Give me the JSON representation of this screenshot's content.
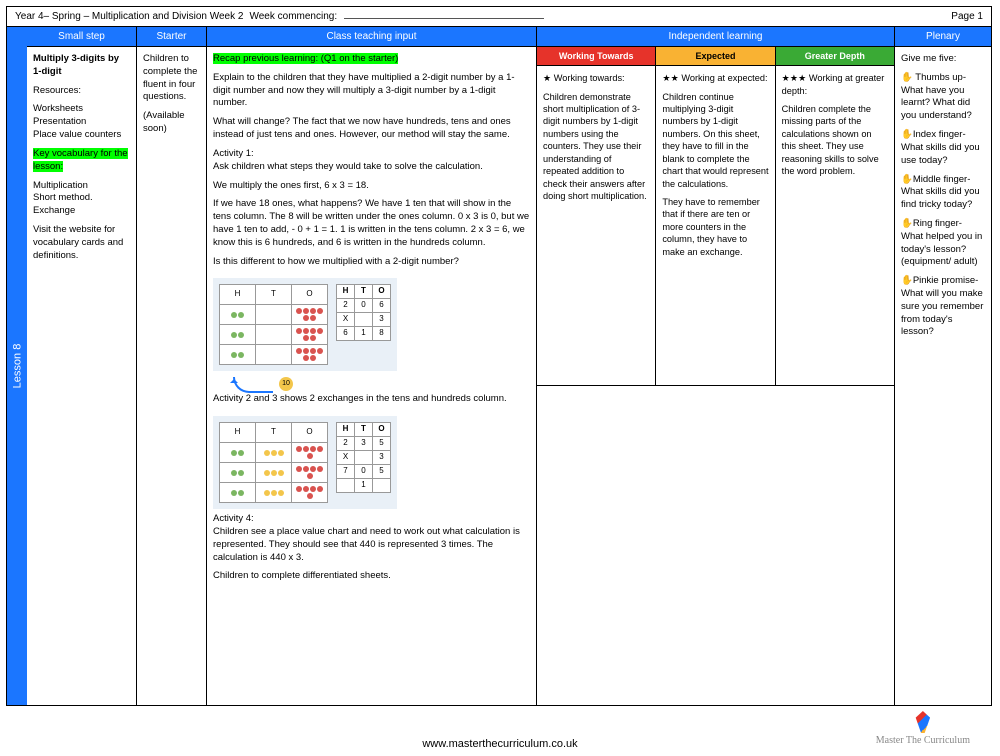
{
  "header": {
    "title": "Year 4– Spring – Multiplication and Division Week 2",
    "week_commencing_label": "Week commencing:",
    "page_label": "Page 1"
  },
  "lesson_tab": "Lesson 8",
  "columns": {
    "small_step": "Small step",
    "starter": "Starter",
    "teaching": "Class teaching input",
    "independent": "Independent learning",
    "plenary": "Plenary"
  },
  "small_step": {
    "title": "Multiply 3-digits by 1-digit",
    "resources_label": "Resources:",
    "resources": "Worksheets\nPresentation\nPlace value counters",
    "vocab_label": "Key vocabulary for the lesson:",
    "vocab": "Multiplication\nShort method.\nExchange",
    "note": "Visit the website for vocabulary cards and definitions."
  },
  "starter": {
    "l1": "Children to complete the fluent in four questions.",
    "l2": "(Available soon)"
  },
  "teaching": {
    "recap": "Recap previous learning: (Q1 on the starter)",
    "p1": "Explain to the children that they have multiplied a 2-digit number by a 1-digit number and now they will multiply a 3-digit number by a 1-digit number.",
    "p2": "What will change? The fact that we now have hundreds, tens and ones instead of just tens and ones. However, our method will stay the same.",
    "act1_label": "Activity 1:",
    "act1_q": "Ask children what steps they would take to solve the calculation.",
    "p3": "We multiply the ones first, 6 x 3 = 18.",
    "p4": "If we have 18 ones, what happens? We have 1 ten that will show in the tens column. The 8 will be written under the ones column. 0 x 3 is 0, but we have 1 ten to add, - 0 + 1 = 1. 1 is written in the tens column. 2 x 3 = 6, we know this is 6 hundreds, and 6 is written in the hundreds column.",
    "p5": "Is this different to how we multiplied with a 2-digit number?",
    "p6": "Activity 2 and 3 shows 2 exchanges in the tens and hundreds column.",
    "act4_label": "Activity 4:",
    "act4_body": "Children see a place value chart and need to work out what calculation is represented. They should see that 440 is represented 3 times. The calculation is 440 x 3.",
    "p7": "Children to complete differentiated sheets."
  },
  "diagram1": {
    "headers": [
      "H",
      "T",
      "O"
    ],
    "calc": {
      "top": [
        "2",
        "0",
        "6"
      ],
      "mult": [
        "X",
        "",
        "3"
      ],
      "ans": [
        "6",
        "1",
        "8"
      ]
    },
    "carry": "10"
  },
  "diagram2": {
    "headers": [
      "H",
      "T",
      "O"
    ],
    "calc": {
      "top": [
        "2",
        "3",
        "5"
      ],
      "mult": [
        "X",
        "",
        "3"
      ],
      "ans": [
        "7",
        "0",
        "5"
      ],
      "carry_row": [
        "",
        "1",
        ""
      ]
    }
  },
  "independent": {
    "wt_head": "Working Towards",
    "ex_head": "Expected",
    "gd_head": "Greater Depth",
    "wt_title": "★ Working towards:",
    "wt_body": "Children demonstrate short multiplication of 3-digit numbers by 1-digit numbers using the counters. They use their understanding of repeated addition to check their answers after doing short multiplication.",
    "ex_title": "★★ Working at expected:",
    "ex_body": "Children continue multiplying 3-digit numbers by 1-digit numbers. On this sheet, they have to fill in the blank to complete the chart that would represent the calculations.",
    "ex_body2": "They have to remember that if there are ten or more counters in the  column, they have to make an exchange.",
    "gd_title": "★★★ Working at greater depth:",
    "gd_body": "Children complete the missing parts of the calculations shown on this sheet. They use reasoning skills to solve the word problem."
  },
  "plenary": {
    "intro": "Give me five:",
    "thumb": "✋ Thumbs up- What have you learnt? What did you understand?",
    "index": "✋Index finger- What skills did you use today?",
    "middle": "✋Middle finger- What skills did you find tricky today?",
    "ring": "✋Ring finger- What helped you in today's lesson? (equipment/ adult)",
    "pinkie": "✋Pinkie promise- What will you make sure you remember from today's lesson?"
  },
  "footer": {
    "url": "www.masterthecurriculum.co.uk",
    "brand": "Master The Curriculum"
  }
}
